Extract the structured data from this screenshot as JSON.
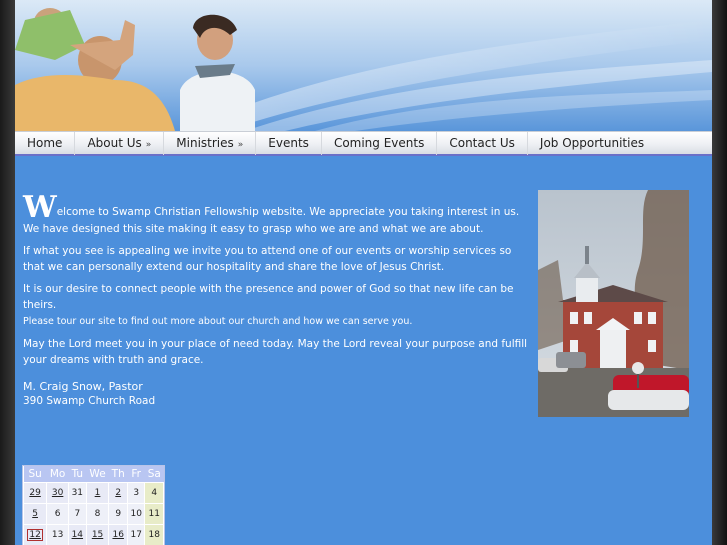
{
  "nav": {
    "items": [
      {
        "label": "Home",
        "submenu": false
      },
      {
        "label": "About Us",
        "submenu": true
      },
      {
        "label": "Ministries",
        "submenu": true
      },
      {
        "label": "Events",
        "submenu": false
      },
      {
        "label": "Coming Events",
        "submenu": false
      },
      {
        "label": "Contact Us",
        "submenu": false
      },
      {
        "label": "Job Opportunities",
        "submenu": false
      }
    ],
    "submenu_glyph": "»"
  },
  "welcome": {
    "dropcap": "W",
    "p1": "elcome to Swamp Christian Fellowship website. We appreciate you taking interest in us. We have designed this site making it easy to grasp who we are and what we are about.",
    "p2": "If what you see is appealing we invite you to attend one of our events or worship services so that we can personally extend our hospitality and share the love of Jesus Christ.",
    "p3a": "It is our desire to connect people with the presence and power of God so that new life can be theirs.",
    "p3b": "Please tour our site to find out more about our church and how we can serve you.",
    "p4": "May the Lord meet you in your place of need today. May the Lord reveal your purpose and fulfill your dreams with truth and grace.",
    "signature": "M. Craig Snow, Pastor",
    "address": "390 Swamp Church Road"
  },
  "calendar": {
    "weekdays": [
      "Su",
      "Mo",
      "Tu",
      "We",
      "Th",
      "Fr",
      "Sa"
    ],
    "weeks": [
      [
        {
          "d": "29",
          "t": "ev"
        },
        {
          "d": "30",
          "t": "ev"
        },
        {
          "d": "31",
          "t": "norm"
        },
        {
          "d": "1",
          "t": "ev"
        },
        {
          "d": "2",
          "t": "ev"
        },
        {
          "d": "3",
          "t": "norm"
        },
        {
          "d": "4",
          "t": "we"
        }
      ],
      [
        {
          "d": "5",
          "t": "ev"
        },
        {
          "d": "6",
          "t": "norm"
        },
        {
          "d": "7",
          "t": "norm"
        },
        {
          "d": "8",
          "t": "norm"
        },
        {
          "d": "9",
          "t": "norm"
        },
        {
          "d": "10",
          "t": "norm"
        },
        {
          "d": "11",
          "t": "we"
        }
      ],
      [
        {
          "d": "12",
          "t": "today"
        },
        {
          "d": "13",
          "t": "norm"
        },
        {
          "d": "14",
          "t": "ev"
        },
        {
          "d": "15",
          "t": "ev"
        },
        {
          "d": "16",
          "t": "ev"
        },
        {
          "d": "17",
          "t": "norm"
        },
        {
          "d": "18",
          "t": "we"
        }
      ]
    ]
  },
  "colors": {
    "page_bg": "#4c8fdc",
    "nav_underline": "#6a6fc8",
    "calendar_header": "#b9c6f2"
  }
}
